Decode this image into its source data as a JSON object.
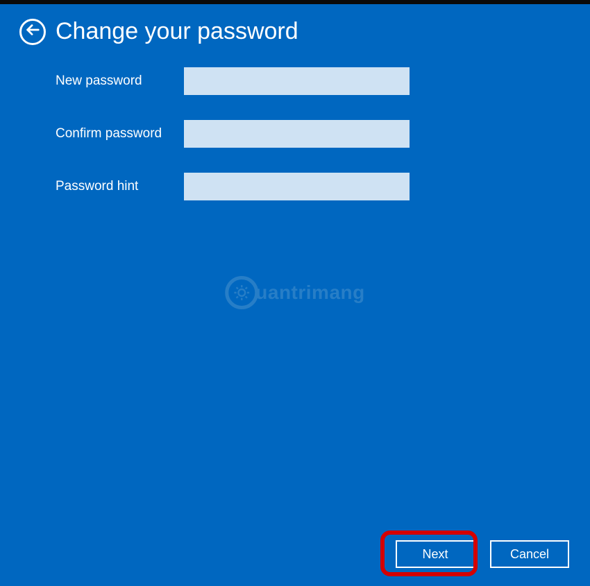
{
  "page": {
    "title": "Change your password"
  },
  "form": {
    "newPasswordLabel": "New password",
    "newPasswordValue": "",
    "confirmPasswordLabel": "Confirm password",
    "confirmPasswordValue": "",
    "passwordHintLabel": "Password hint",
    "passwordHintValue": ""
  },
  "watermark": {
    "text": "uantrimang"
  },
  "buttons": {
    "next": "Next",
    "cancel": "Cancel"
  }
}
